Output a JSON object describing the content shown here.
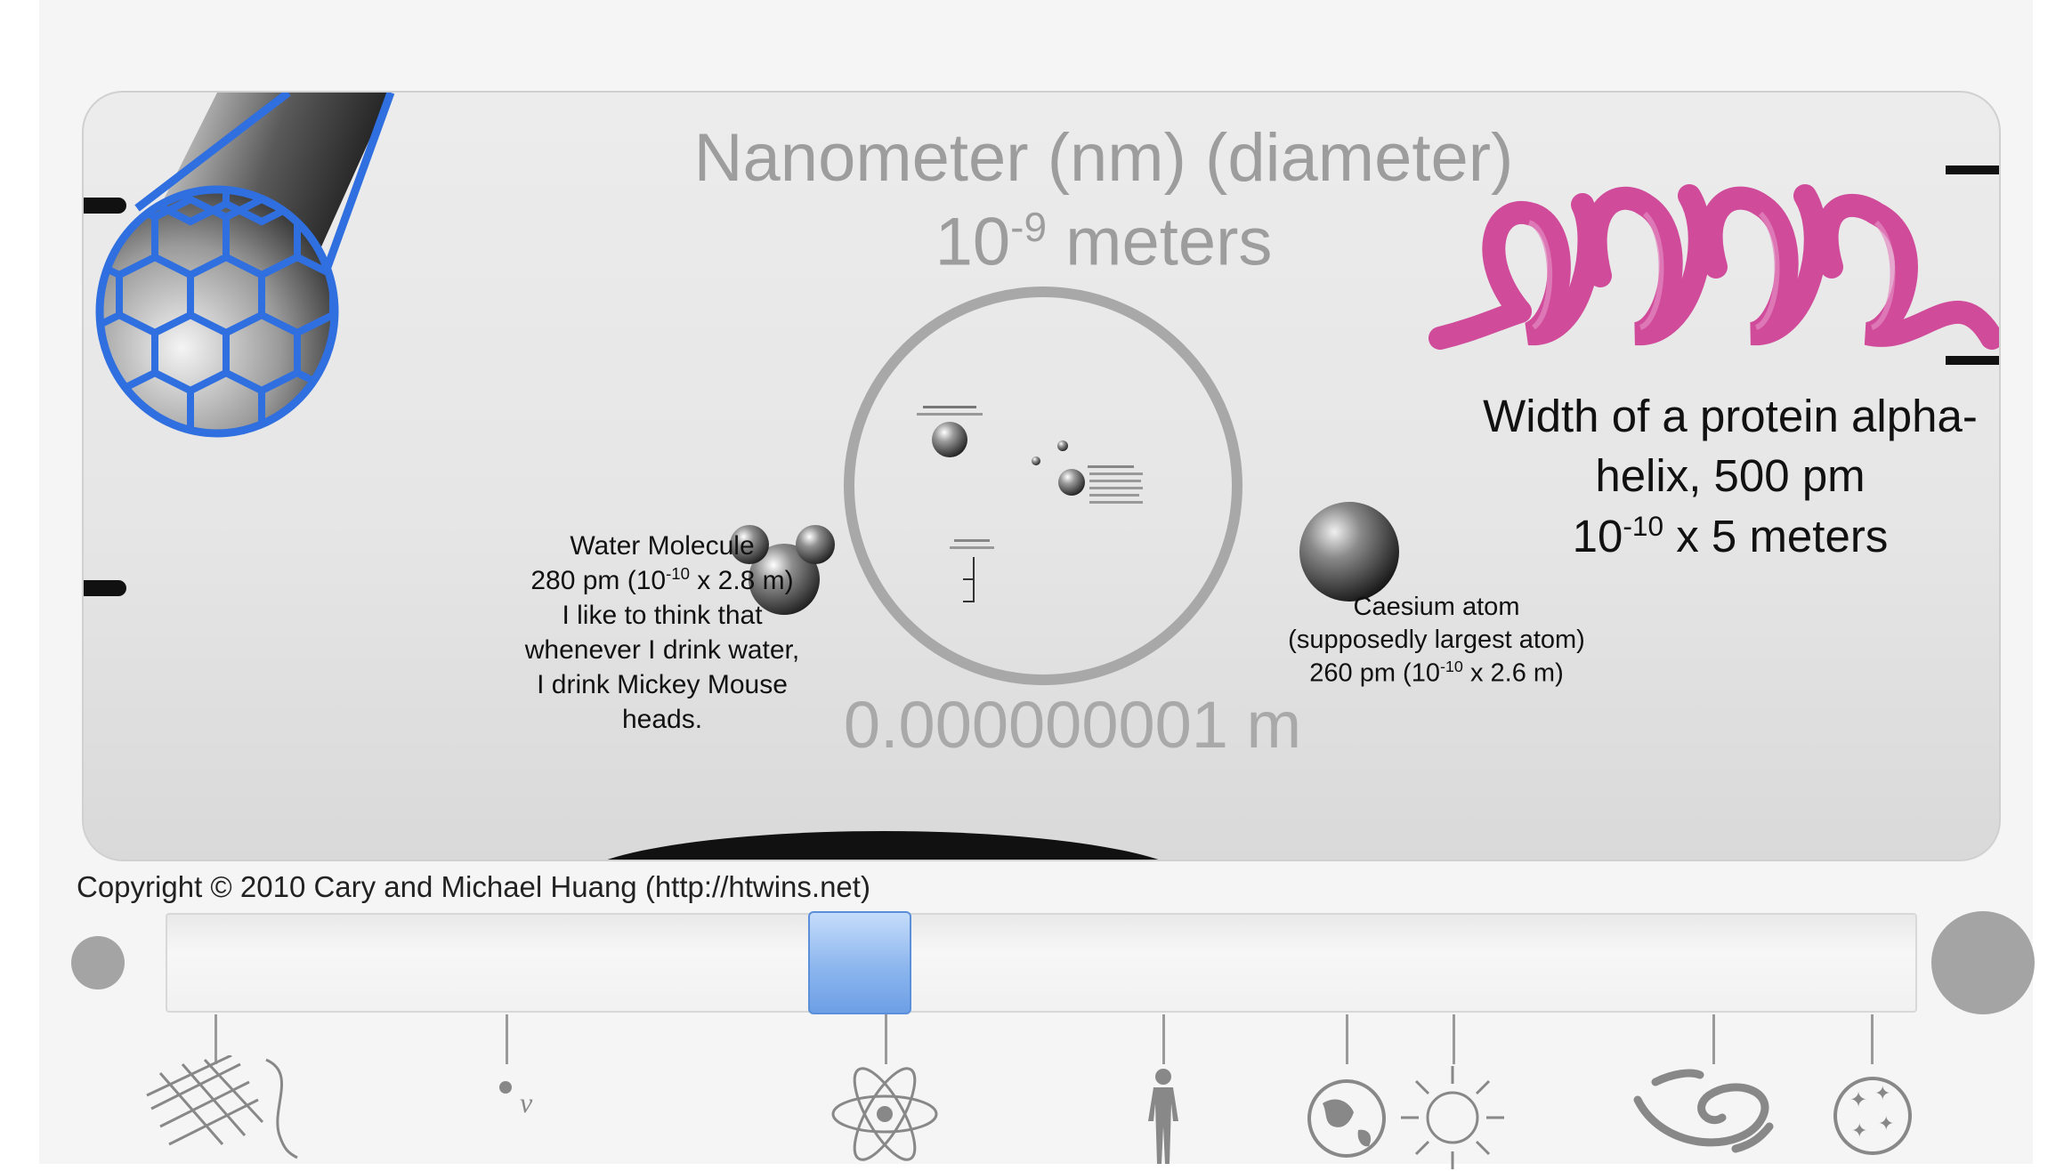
{
  "scale": {
    "title": "Nanometer (nm) (diameter)",
    "power_base": "10",
    "power_exp": "-9",
    "power_unit": " meters",
    "distance": "0.000000001 m"
  },
  "water": {
    "line1": "Water Molecule",
    "line2_a": "280 pm (10",
    "line2_exp": "-10",
    "line2_b": " x 2.8 m)",
    "line3": "I like to think that",
    "line4": "whenever I drink water,",
    "line5": "I drink Mickey Mouse",
    "line6": "heads."
  },
  "caesium": {
    "line1": "Caesium atom",
    "line2": "(supposedly largest atom)",
    "line3_a": "260 pm (10",
    "line3_exp": "-10",
    "line3_b": " x 2.6 m)"
  },
  "helix": {
    "line1": "Width of a protein alpha-",
    "line2": "helix, 500 pm",
    "line3_a": "10",
    "line3_exp": "-10",
    "line3_b": " x 5 meters"
  },
  "copyright": "Copyright © 2010 Cary and Michael Huang (http://htwins.net)",
  "slider": {
    "position": 0.39
  },
  "colors": {
    "accent": "#6d9fe6",
    "helix": "#d04b9a",
    "nanotube_blue": "#2f6fe0"
  },
  "icons": [
    "planck-grid-icon",
    "string-icon",
    "neutrino-icon",
    "atom-icon",
    "human-icon",
    "earth-icon",
    "sun-icon",
    "galaxy-icon",
    "universe-icon"
  ]
}
